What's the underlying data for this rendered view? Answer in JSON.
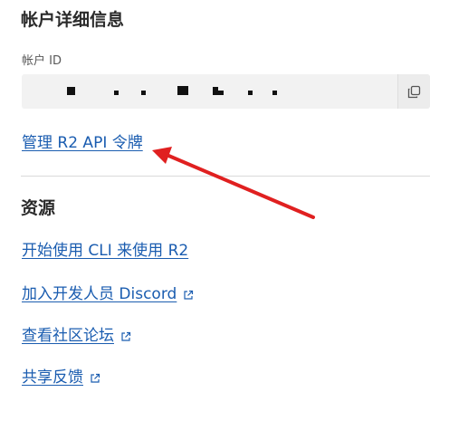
{
  "account": {
    "title": "帐户详细信息",
    "id_label": "帐户 ID",
    "copy_icon": "copy-icon",
    "manage_link": "管理 R2 API 令牌"
  },
  "resources": {
    "title": "资源",
    "links": [
      {
        "label": "开始使用 CLI 来使用 R2",
        "external": false
      },
      {
        "label": "加入开发人员 Discord",
        "external": true,
        "icon": "external-link-icon"
      },
      {
        "label": "查看社区论坛",
        "external": true,
        "icon": "external-link-icon"
      },
      {
        "label": "共享反馈",
        "external": true,
        "icon": "external-link-icon"
      }
    ]
  },
  "colors": {
    "link": "#1b5db0",
    "annotation_arrow": "#e02020",
    "field_background": "#f2f2f2"
  }
}
